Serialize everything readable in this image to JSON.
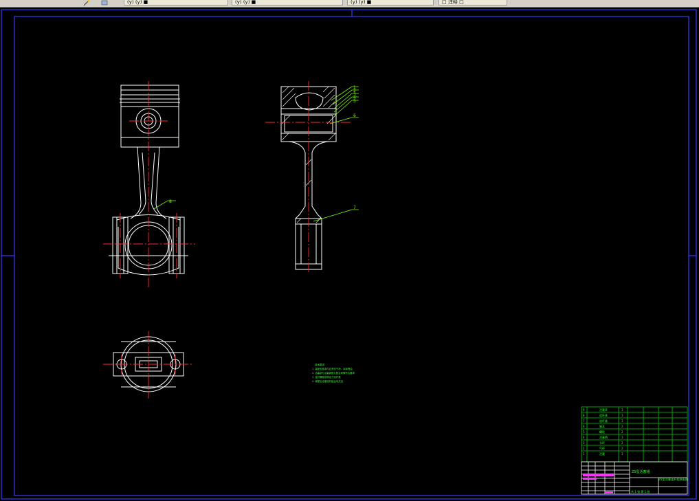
{
  "window": {
    "toolbar_tabs": [
      {
        "label": "(y) (y) ■"
      },
      {
        "label": "(y) (y) ■"
      },
      {
        "label": "(y) (y) ■"
      },
      {
        "label": "□ 注释 □"
      }
    ]
  },
  "drawing": {
    "balloons": [
      "1",
      "2",
      "3",
      "4",
      "5",
      "6",
      "7",
      "8"
    ],
    "tech_notes_title": "技术要求",
    "tech_notes": [
      "1. 装配前各零件应清洗干净，涂润滑油",
      "2. 活塞销与活塞销座孔配合间隙符合要求",
      "3. 连杆螺栓按规定力矩拧紧",
      "4. 装配后活塞连杆组运动灵活"
    ],
    "bom": {
      "rows": [
        {
          "no": "9",
          "name": "活塞环",
          "qty": "1"
        },
        {
          "no": "8",
          "name": "连杆体",
          "qty": "1"
        },
        {
          "no": "7",
          "name": "连杆盖",
          "qty": "1"
        },
        {
          "no": "6",
          "name": "轴瓦",
          "qty": "2"
        },
        {
          "no": "5",
          "name": "螺栓",
          "qty": "2"
        },
        {
          "no": "4",
          "name": "活塞销",
          "qty": "1"
        },
        {
          "no": "3",
          "name": "卡环",
          "qty": "2"
        },
        {
          "no": "2",
          "name": "气环",
          "qty": "2"
        },
        {
          "no": "1",
          "name": "活塞",
          "qty": "1"
        }
      ],
      "title_small": "Z5型活塞组",
      "title_main": "Z5型活塞连杆组装配图",
      "footer": "共 1 张 第 1 张"
    }
  },
  "colors": {
    "background": "#000000",
    "geometry": "#ffffff",
    "centerline": "#ff2a2a",
    "leader": "#7cfc00",
    "border": "#3a3aff",
    "bom_line": "#00cc00",
    "bom_text": "#33ff33",
    "magenta": "#ff33ff"
  }
}
